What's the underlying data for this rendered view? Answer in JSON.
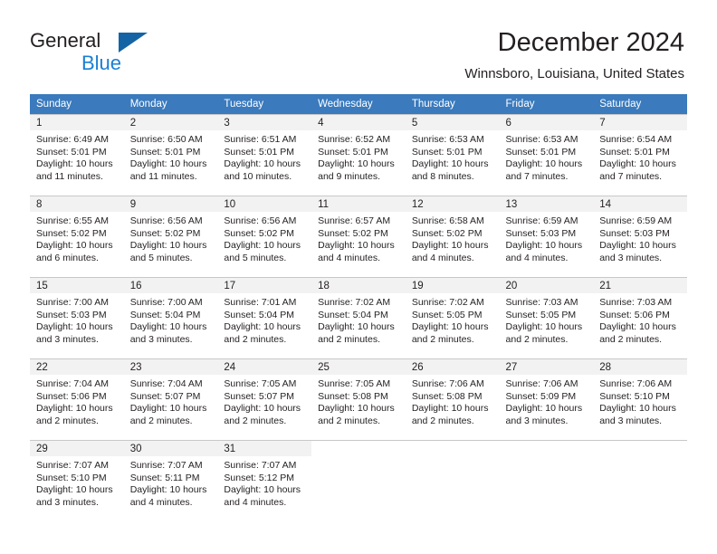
{
  "brand": {
    "name_top": "General",
    "name_bottom": "Blue",
    "triangle_color": "#1464a5",
    "blue_text_color": "#1a7fd4"
  },
  "header": {
    "title": "December 2024",
    "subtitle": "Winnsboro, Louisiana, United States"
  },
  "theme": {
    "header_bg": "#3a7abd",
    "daynum_bg": "#f2f2f2",
    "grid_line": "#c8c8c8",
    "text": "#231f20"
  },
  "weekdays": [
    "Sunday",
    "Monday",
    "Tuesday",
    "Wednesday",
    "Thursday",
    "Friday",
    "Saturday"
  ],
  "labels": {
    "sunrise_prefix": "Sunrise:",
    "sunset_prefix": "Sunset:",
    "daylight_prefix": "Daylight:"
  },
  "chart_data": {
    "type": "table",
    "title": "December 2024 — Sunrise, Sunset and Daylight",
    "location": "Winnsboro, Louisiana, United States",
    "columns": [
      "Sunday",
      "Monday",
      "Tuesday",
      "Wednesday",
      "Thursday",
      "Friday",
      "Saturday"
    ],
    "rows": [
      [
        {
          "day": "1",
          "sunrise": "6:49 AM",
          "sunset": "5:01 PM",
          "daylight_hours": 10,
          "daylight_minutes": 11
        },
        {
          "day": "2",
          "sunrise": "6:50 AM",
          "sunset": "5:01 PM",
          "daylight_hours": 10,
          "daylight_minutes": 11
        },
        {
          "day": "3",
          "sunrise": "6:51 AM",
          "sunset": "5:01 PM",
          "daylight_hours": 10,
          "daylight_minutes": 10
        },
        {
          "day": "4",
          "sunrise": "6:52 AM",
          "sunset": "5:01 PM",
          "daylight_hours": 10,
          "daylight_minutes": 9
        },
        {
          "day": "5",
          "sunrise": "6:53 AM",
          "sunset": "5:01 PM",
          "daylight_hours": 10,
          "daylight_minutes": 8
        },
        {
          "day": "6",
          "sunrise": "6:53 AM",
          "sunset": "5:01 PM",
          "daylight_hours": 10,
          "daylight_minutes": 7
        },
        {
          "day": "7",
          "sunrise": "6:54 AM",
          "sunset": "5:01 PM",
          "daylight_hours": 10,
          "daylight_minutes": 7
        }
      ],
      [
        {
          "day": "8",
          "sunrise": "6:55 AM",
          "sunset": "5:02 PM",
          "daylight_hours": 10,
          "daylight_minutes": 6
        },
        {
          "day": "9",
          "sunrise": "6:56 AM",
          "sunset": "5:02 PM",
          "daylight_hours": 10,
          "daylight_minutes": 5
        },
        {
          "day": "10",
          "sunrise": "6:56 AM",
          "sunset": "5:02 PM",
          "daylight_hours": 10,
          "daylight_minutes": 5
        },
        {
          "day": "11",
          "sunrise": "6:57 AM",
          "sunset": "5:02 PM",
          "daylight_hours": 10,
          "daylight_minutes": 4
        },
        {
          "day": "12",
          "sunrise": "6:58 AM",
          "sunset": "5:02 PM",
          "daylight_hours": 10,
          "daylight_minutes": 4
        },
        {
          "day": "13",
          "sunrise": "6:59 AM",
          "sunset": "5:03 PM",
          "daylight_hours": 10,
          "daylight_minutes": 4
        },
        {
          "day": "14",
          "sunrise": "6:59 AM",
          "sunset": "5:03 PM",
          "daylight_hours": 10,
          "daylight_minutes": 3
        }
      ],
      [
        {
          "day": "15",
          "sunrise": "7:00 AM",
          "sunset": "5:03 PM",
          "daylight_hours": 10,
          "daylight_minutes": 3
        },
        {
          "day": "16",
          "sunrise": "7:00 AM",
          "sunset": "5:04 PM",
          "daylight_hours": 10,
          "daylight_minutes": 3
        },
        {
          "day": "17",
          "sunrise": "7:01 AM",
          "sunset": "5:04 PM",
          "daylight_hours": 10,
          "daylight_minutes": 2
        },
        {
          "day": "18",
          "sunrise": "7:02 AM",
          "sunset": "5:04 PM",
          "daylight_hours": 10,
          "daylight_minutes": 2
        },
        {
          "day": "19",
          "sunrise": "7:02 AM",
          "sunset": "5:05 PM",
          "daylight_hours": 10,
          "daylight_minutes": 2
        },
        {
          "day": "20",
          "sunrise": "7:03 AM",
          "sunset": "5:05 PM",
          "daylight_hours": 10,
          "daylight_minutes": 2
        },
        {
          "day": "21",
          "sunrise": "7:03 AM",
          "sunset": "5:06 PM",
          "daylight_hours": 10,
          "daylight_minutes": 2
        }
      ],
      [
        {
          "day": "22",
          "sunrise": "7:04 AM",
          "sunset": "5:06 PM",
          "daylight_hours": 10,
          "daylight_minutes": 2
        },
        {
          "day": "23",
          "sunrise": "7:04 AM",
          "sunset": "5:07 PM",
          "daylight_hours": 10,
          "daylight_minutes": 2
        },
        {
          "day": "24",
          "sunrise": "7:05 AM",
          "sunset": "5:07 PM",
          "daylight_hours": 10,
          "daylight_minutes": 2
        },
        {
          "day": "25",
          "sunrise": "7:05 AM",
          "sunset": "5:08 PM",
          "daylight_hours": 10,
          "daylight_minutes": 2
        },
        {
          "day": "26",
          "sunrise": "7:06 AM",
          "sunset": "5:08 PM",
          "daylight_hours": 10,
          "daylight_minutes": 2
        },
        {
          "day": "27",
          "sunrise": "7:06 AM",
          "sunset": "5:09 PM",
          "daylight_hours": 10,
          "daylight_minutes": 3
        },
        {
          "day": "28",
          "sunrise": "7:06 AM",
          "sunset": "5:10 PM",
          "daylight_hours": 10,
          "daylight_minutes": 3
        }
      ],
      [
        {
          "day": "29",
          "sunrise": "7:07 AM",
          "sunset": "5:10 PM",
          "daylight_hours": 10,
          "daylight_minutes": 3
        },
        {
          "day": "30",
          "sunrise": "7:07 AM",
          "sunset": "5:11 PM",
          "daylight_hours": 10,
          "daylight_minutes": 4
        },
        {
          "day": "31",
          "sunrise": "7:07 AM",
          "sunset": "5:12 PM",
          "daylight_hours": 10,
          "daylight_minutes": 4
        },
        null,
        null,
        null,
        null
      ]
    ]
  }
}
